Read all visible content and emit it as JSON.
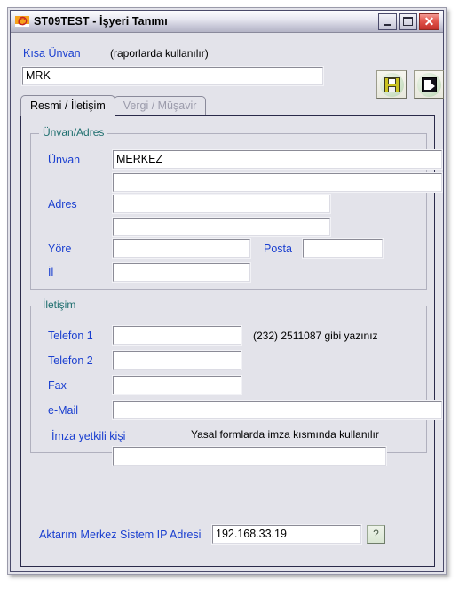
{
  "window": {
    "title": "ST09TEST - İşyeri Tanımı",
    "app_icon": "app-logo-icon",
    "controls": {
      "minimize": "_",
      "maximize": "□",
      "close": "✕"
    }
  },
  "toolbar": {
    "save": {
      "label": "",
      "icon": "floppy-disk-save-icon",
      "tooltip": "Kaydet"
    },
    "exit": {
      "label": "",
      "icon": "exit-door-icon",
      "tooltip": "Çıkış"
    }
  },
  "short_title": {
    "label": "Kısa Ünvan",
    "hint": "(raporlarda kullanılır)",
    "value": "MRK",
    "placeholder": ""
  },
  "tabs": [
    {
      "label": "Resmi / İletişim",
      "state": "active"
    },
    {
      "label": "Vergi / Müşavir",
      "state": "disabled"
    }
  ],
  "group_address": {
    "legend": "Ünvan/Adres",
    "fields": {
      "unvan_label": "Ünvan",
      "unvan_line1": "MERKEZ",
      "unvan_line2": "",
      "adres_label": "Adres",
      "adres_line1": "",
      "adres_line2": "",
      "yore_label": "Yöre",
      "yore_value": "",
      "posta_label": "Posta",
      "posta_value": "",
      "il_label": "İl",
      "il_value": ""
    }
  },
  "group_contact": {
    "legend": "İletişim",
    "fields": {
      "telefon1_label": "Telefon 1",
      "telefon1_value": "",
      "telefon1_hint": "(232) 2511087 gibi yazınız",
      "telefon2_label": "Telefon 2",
      "telefon2_value": "",
      "fax_label": "Fax",
      "fax_value": "",
      "email_label": "e-Mail",
      "email_value": "",
      "imza_label": "İmza yetkili kişi",
      "imza_hint": "Yasal formlarda imza kısmında kullanılır",
      "imza_value": ""
    }
  },
  "transfer": {
    "label": "Aktarım Merkez Sistem IP Adresi",
    "value": "192.168.33.19",
    "help_glyph": "?"
  },
  "colors": {
    "label_blue": "#1a3fd0",
    "legend_teal": "#1f6f6f",
    "dialog_bg": "#e3e3ea",
    "field_bg": "#ffffff",
    "close_red": "#e2564c",
    "disabled_tab": "#9b9bab"
  }
}
